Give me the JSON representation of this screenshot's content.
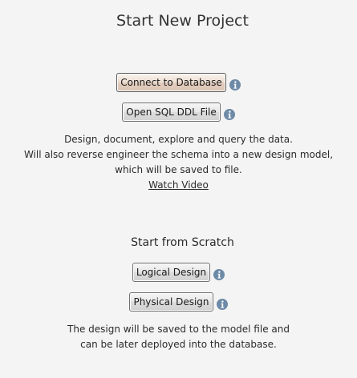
{
  "header": {
    "title": "Start New Project"
  },
  "existing": {
    "connect_button": "Connect to Database",
    "open_ddl_button": "Open SQL DDL File",
    "description": [
      "Design, document, explore and query the data.",
      "Will also reverse engineer the schema into a new design model,",
      "which will be saved to file."
    ],
    "video_link": "Watch Video"
  },
  "scratch": {
    "title": "Start from Scratch",
    "logical_button": "Logical Design",
    "physical_button": "Physical Design",
    "description": [
      "The design will be saved to the model file and",
      "can be later deployed into the database."
    ]
  },
  "icons": {
    "info": "info-icon",
    "info_color": "#6d8aa7"
  }
}
